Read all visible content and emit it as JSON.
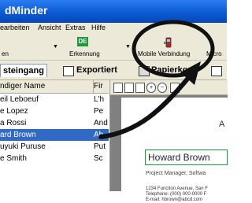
{
  "window": {
    "title": "dMinder"
  },
  "menu": {
    "items": [
      "earbeiten",
      "Ansicht",
      "Extras",
      "Hilfe"
    ]
  },
  "toolbar": {
    "left_label": "en",
    "de_icon": "DE",
    "erkennung_label": "Erkennung",
    "mobile_label": "Mobile Verbindung",
    "micro_label": "Micro"
  },
  "tabs": {
    "eingang": "steingang",
    "export": "Exportiert",
    "papier": "Papierkorb"
  },
  "list": {
    "headers": [
      "ndiger Name",
      "Fir"
    ],
    "rows": [
      {
        "name": "eil Leboeuf",
        "company": "L'h"
      },
      {
        "name": "e Lopez",
        "company": "Pe"
      },
      {
        "name": "a Rossi",
        "company": "And"
      },
      {
        "name": "ard Brown",
        "company": "Ab"
      },
      {
        "name": "uyuki Puruse",
        "company": "Put"
      },
      {
        "name": "e Smith",
        "company": "Sc"
      }
    ]
  },
  "preview": {
    "heading_letter": "A",
    "name": "Howard Brown",
    "role": "Project Manager, Softwa",
    "address_lines": [
      "1234 Funciton Avenue, San F",
      "Telephone: (000) 000-0000  F",
      "E-mail: hbrown@abcd.com"
    ]
  },
  "annotation": {
    "circle_color": "#111111",
    "arrow_color": "#111111"
  }
}
